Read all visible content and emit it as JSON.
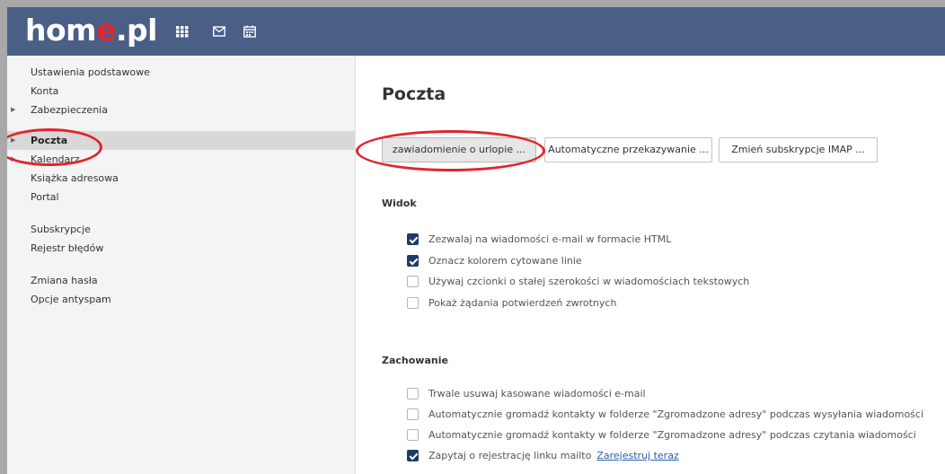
{
  "header": {
    "logo_text_a": "hom",
    "logo_text_accent": "e",
    "logo_text_b": ".pl",
    "bg_color": "#4a5f86",
    "icons": [
      "apps-grid-icon",
      "mail-icon",
      "calendar-icon"
    ]
  },
  "sidebar": {
    "items": [
      {
        "label": "Ustawienia podstawowe"
      },
      {
        "label": "Konta"
      },
      {
        "label": "Zabezpieczenia",
        "arrow": "▶"
      },
      {
        "label": "Poczta",
        "arrow": "▶",
        "active": true
      },
      {
        "label": "Kalendarz",
        "arrow": "▶"
      },
      {
        "label": "Książka adresowa"
      },
      {
        "label": "Portal"
      },
      {
        "label": "Subskrypcje"
      },
      {
        "label": "Rejestr błędów"
      },
      {
        "label": "Zmiana hasła"
      },
      {
        "label": "Opcje antyspam"
      }
    ]
  },
  "main": {
    "title": "Poczta",
    "buttons": [
      {
        "label": "zawiadomienie o urlopie ...",
        "pressed": true
      },
      {
        "label": "Automatyczne przekazywanie ..."
      },
      {
        "label": "Zmień subskrypcje IMAP ..."
      }
    ],
    "view": {
      "heading": "Widok",
      "options": [
        {
          "label": "Zezwalaj na wiadomości e-mail w formacie HTML",
          "checked": true
        },
        {
          "label": "Oznacz kolorem cytowane linie",
          "checked": true
        },
        {
          "label": "Używaj czcionki o stałej szerokości w wiadomościach tekstowych",
          "checked": false
        },
        {
          "label": "Pokaż żądania potwierdzeń zwrotnych",
          "checked": false
        }
      ]
    },
    "behavior": {
      "heading": "Zachowanie",
      "options": [
        {
          "label": "Trwale usuwaj kasowane wiadomości e-mail",
          "checked": false
        },
        {
          "label": "Automatycznie gromadź kontakty w folderze \"Zgromadzone adresy\" podczas wysyłania wiadomości",
          "checked": false
        },
        {
          "label": "Automatycznie gromadź kontakty w folderze \"Zgromadzone adresy\" podczas czytania wiadomości",
          "checked": false
        },
        {
          "label": "Zapytaj o rejestrację linku mailto",
          "checked": true,
          "link": "Zarejestruj teraz"
        }
      ]
    }
  },
  "colors": {
    "accent_red": "#e3262f",
    "annotation_red": "#e0242c",
    "checkbox_on": "#1f3b66"
  }
}
